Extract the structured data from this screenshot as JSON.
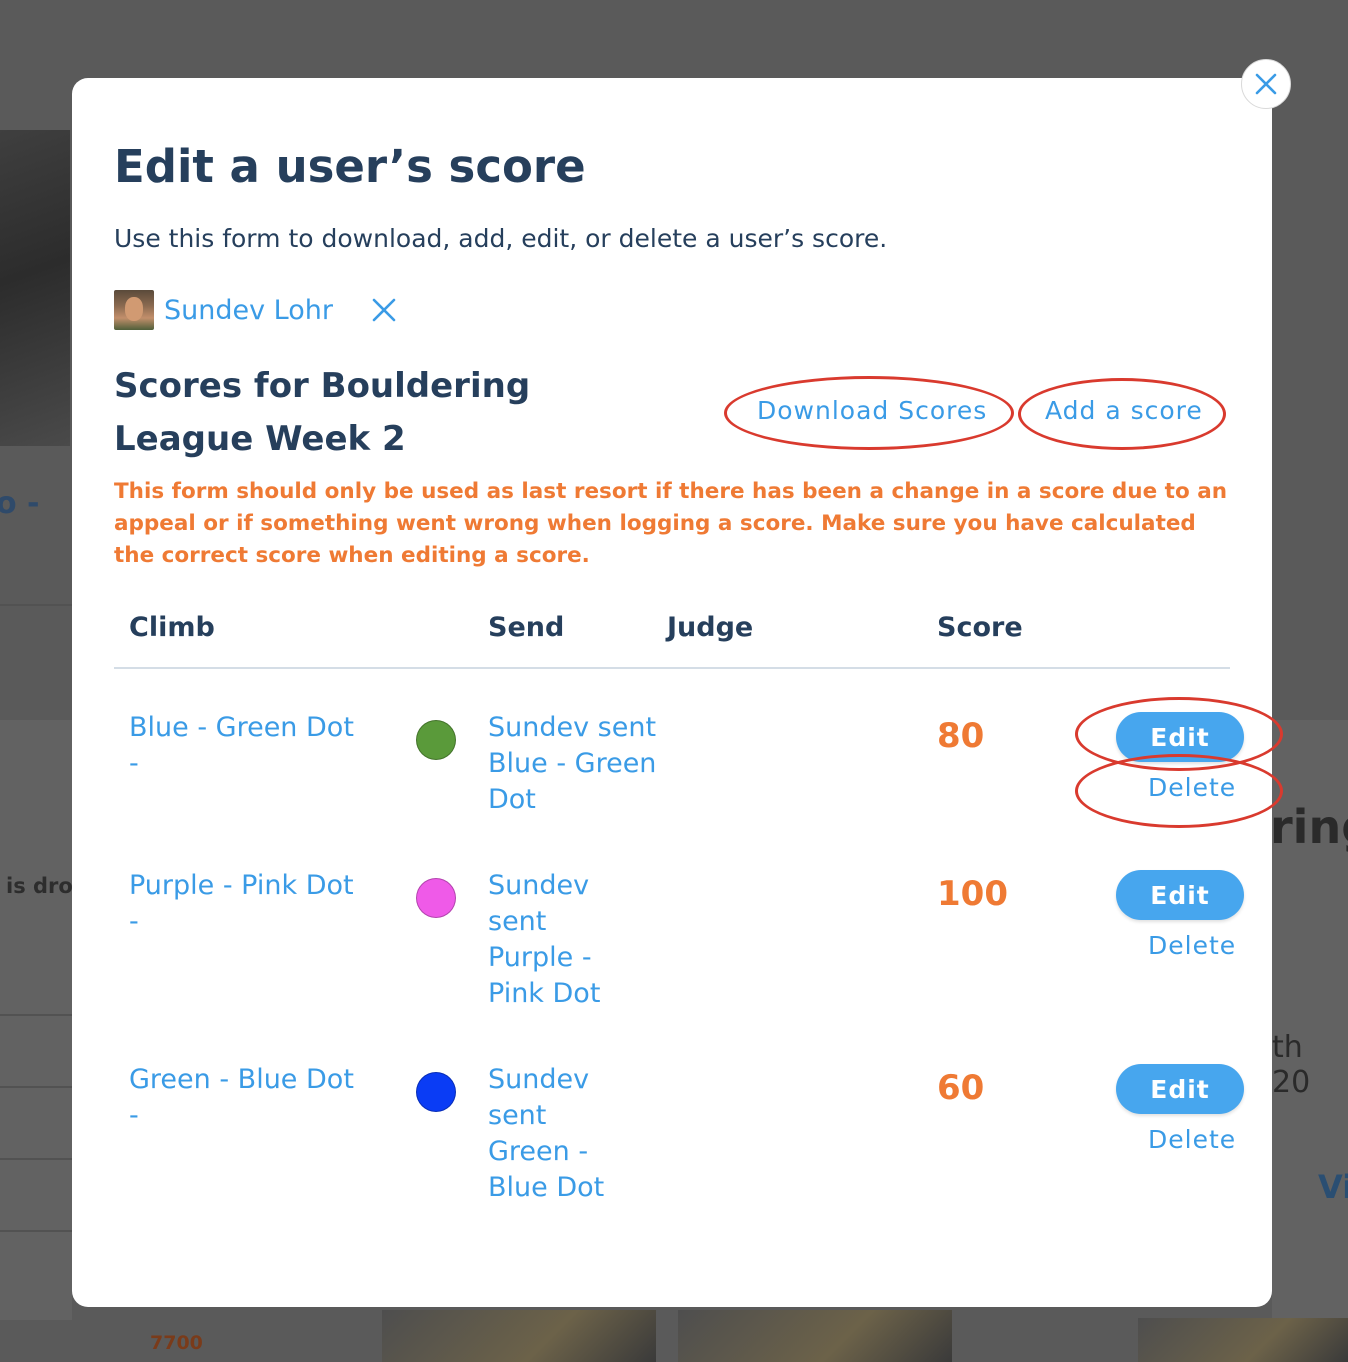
{
  "background": {
    "left_text_1": "o -",
    "left_text_2": "is dro",
    "right_text_1": "ring",
    "right_text_2": "th 20",
    "right_text_3": "Vi",
    "bottom_number": "7700"
  },
  "modal": {
    "close_icon": "close-icon",
    "title": "Edit a user’s score",
    "subtitle": "Use this form to download, add, edit, or delete a user’s score.",
    "user": {
      "name": "Sundev Lohr",
      "clear_icon": "close-icon"
    },
    "scores_heading": "Scores for Bouldering League Week 2",
    "download_label": "Download Scores",
    "add_score_label": "Add a score",
    "warning": "This form should only be used as last resort if there has been a change in a score due to an appeal or if something went wrong when logging a score. Make sure you have calculated the correct score when editing a score.",
    "table": {
      "headers": [
        "Climb",
        "Send",
        "Judge",
        "Score"
      ],
      "rows": [
        {
          "climb": "Blue - Green Dot -",
          "dot_color": "#5a9a3a",
          "send": "Sundev sent Blue - Green Dot",
          "judge": "",
          "score": "80",
          "edit": "Edit",
          "delete": "Delete"
        },
        {
          "climb": "Purple - Pink Dot -",
          "dot_color": "#ef5ae8",
          "send": "Sundev sent Purple - Pink Dot",
          "judge": "",
          "score": "100",
          "edit": "Edit",
          "delete": "Delete"
        },
        {
          "climb": "Green - Blue Dot -",
          "dot_color": "#0a3cf5",
          "send": "Sundev sent Green - Blue Dot",
          "judge": "",
          "score": "60",
          "edit": "Edit",
          "delete": "Delete"
        }
      ]
    }
  },
  "colors": {
    "accent": "#3a9be6",
    "button": "#47a6ee",
    "heading": "#263f5c",
    "warning": "#ef7a34",
    "annotation": "#d93a2e"
  }
}
